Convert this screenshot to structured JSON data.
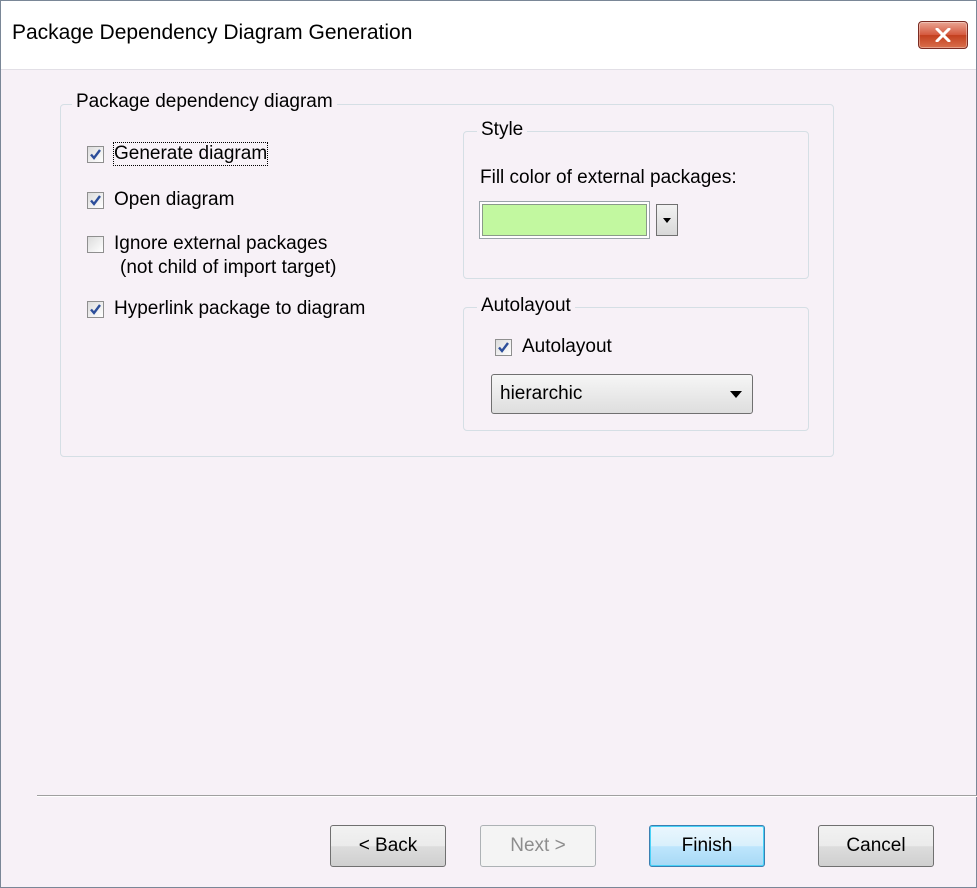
{
  "window": {
    "title": "Package Dependency Diagram Generation"
  },
  "main_group": {
    "legend": "Package dependency diagram",
    "options": [
      {
        "label": "Generate diagram",
        "checked": true
      },
      {
        "label": "Open diagram",
        "checked": true
      },
      {
        "label": "Ignore external packages",
        "sublabel": "(not child of import target)",
        "checked": false
      },
      {
        "label": "Hyperlink package to diagram",
        "checked": true
      }
    ]
  },
  "style_group": {
    "legend": "Style",
    "fill_label": "Fill color of external packages:",
    "fill_color": "#c2f8a0"
  },
  "autolayout_group": {
    "legend": "Autolayout",
    "checkbox_label": "Autolayout",
    "checked": true,
    "select_value": "hierarchic"
  },
  "buttons": {
    "back": "< Back",
    "next": "Next >",
    "finish": "Finish",
    "cancel": "Cancel"
  }
}
